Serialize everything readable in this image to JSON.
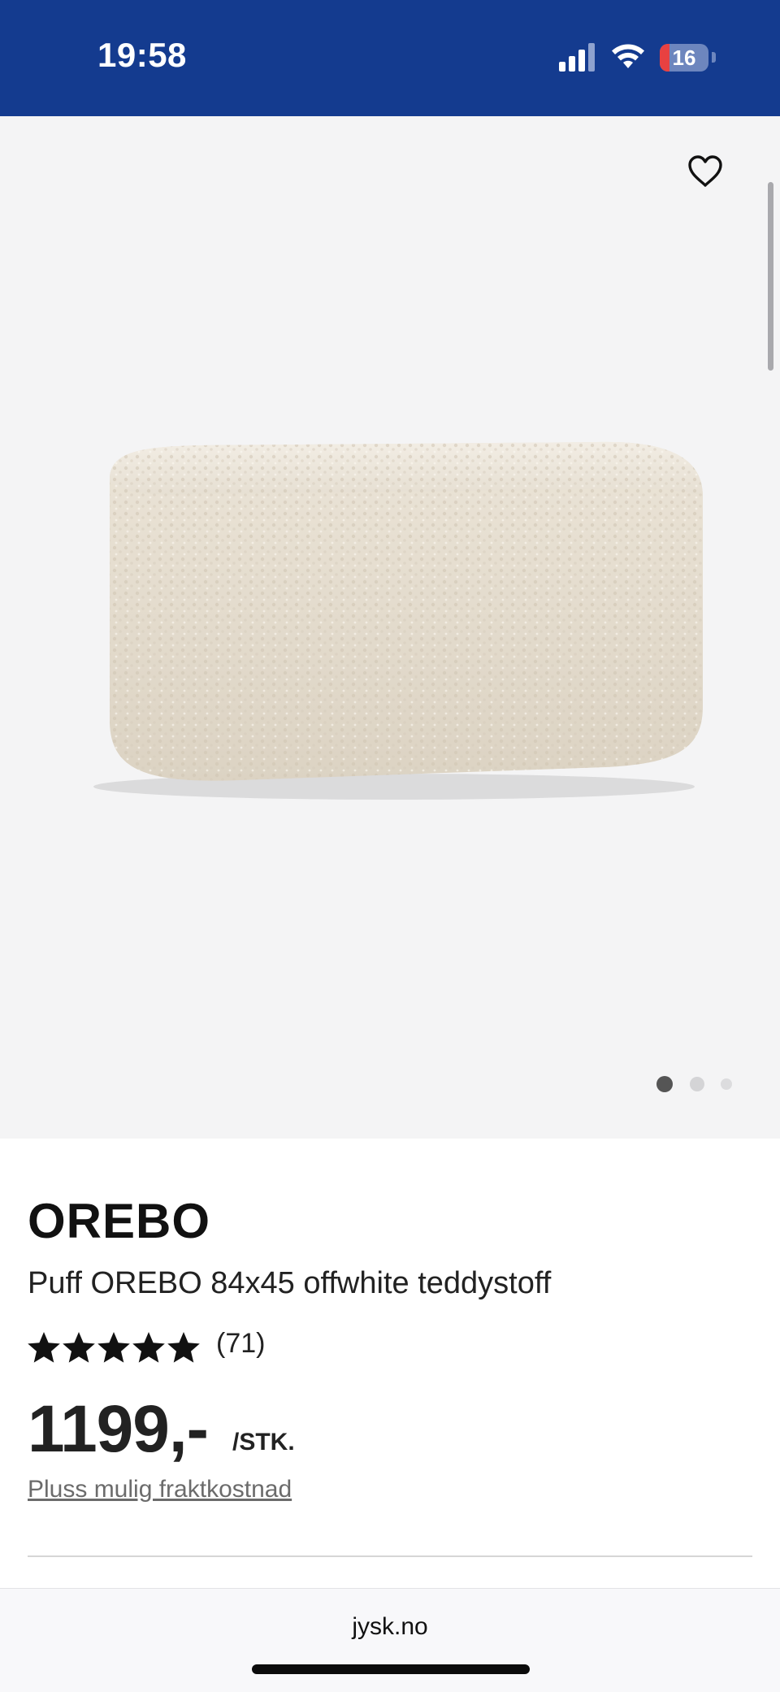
{
  "status_bar": {
    "time": "19:58",
    "battery_level": "16",
    "icons": [
      "signal-icon",
      "wifi-icon",
      "battery-icon"
    ],
    "bg_color": "#143b8f"
  },
  "gallery": {
    "favorite_icon": "heart-outline-icon",
    "image_subject": "offwhite teddy pouf",
    "slide_count": 3,
    "active_slide": 1
  },
  "product": {
    "brand": "OREBO",
    "name": "Puff OREBO 84x45 offwhite teddystoff",
    "rating_stars": 5,
    "review_count": "(71)",
    "price": "1199,-",
    "unit": "/STK.",
    "shipping_note": "Pluss mulig fraktkostnad"
  },
  "browser": {
    "url": "jysk.no"
  }
}
